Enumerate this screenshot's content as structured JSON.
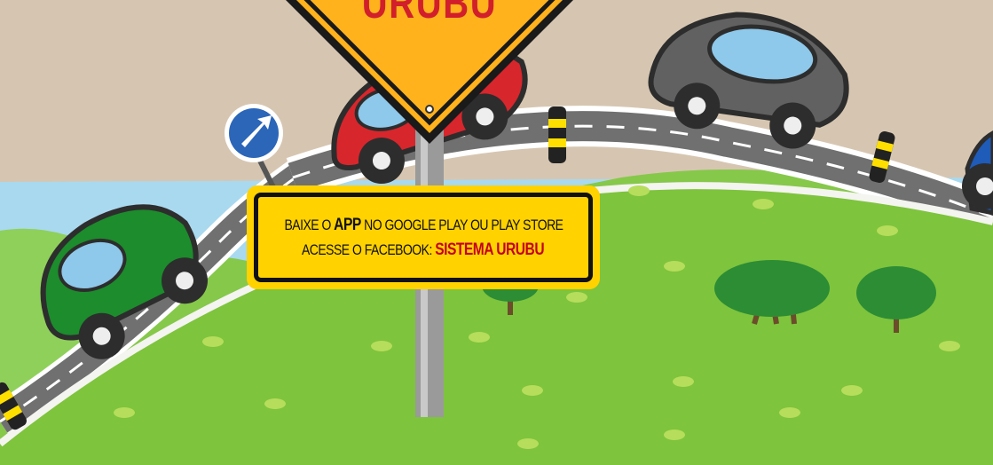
{
  "sign": {
    "title": "URUBU"
  },
  "notice": {
    "line1_pre": "BAIXE O",
    "line1_bold": "APP",
    "line1_post": "NO GOOGLE PLAY OU PLAY STORE",
    "line2_pre": "ACESSE O FACEBOOK:",
    "line2_highlight": "SISTEMA URUBU"
  },
  "colors": {
    "sky": "#d6c6b1",
    "grass": "#7ec43c",
    "road": "#6b6b6b",
    "sign_yellow": "#ffd200",
    "text_red": "#c4001a"
  }
}
